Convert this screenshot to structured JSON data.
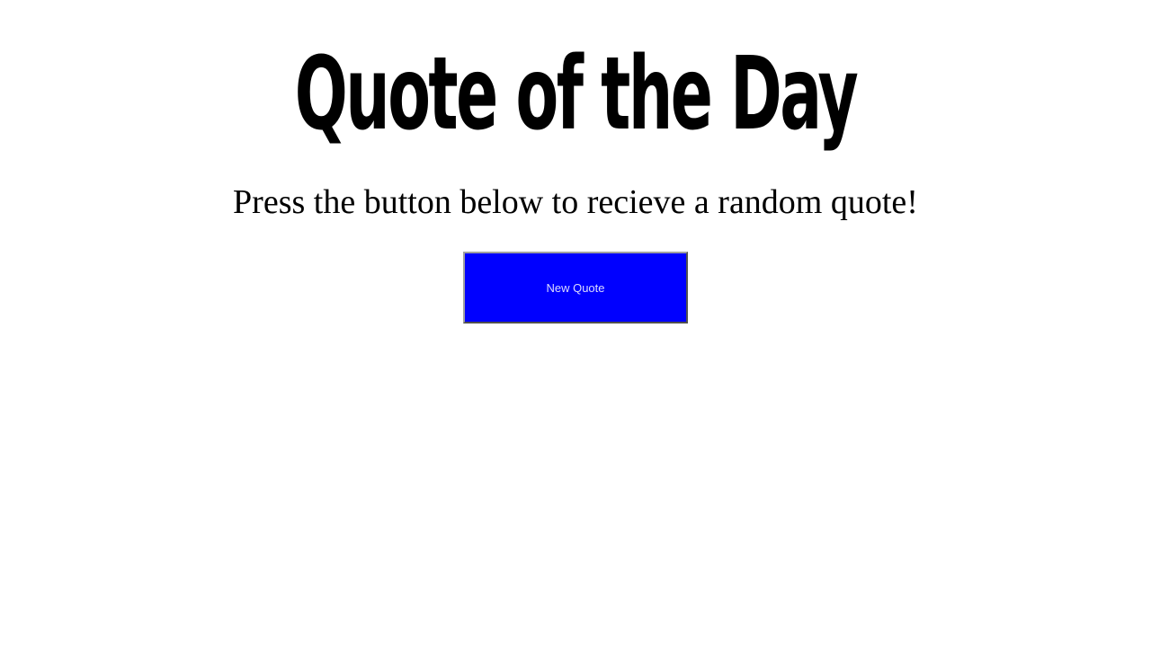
{
  "header": {
    "title": "Quote of the Day"
  },
  "main": {
    "instruction": "Press the button below to recieve a random quote!",
    "new_quote_button_label": "New Quote"
  },
  "colors": {
    "background": "#ffffff",
    "text": "#000000",
    "button_background": "#0000ff",
    "button_text": "#dcdcff"
  }
}
